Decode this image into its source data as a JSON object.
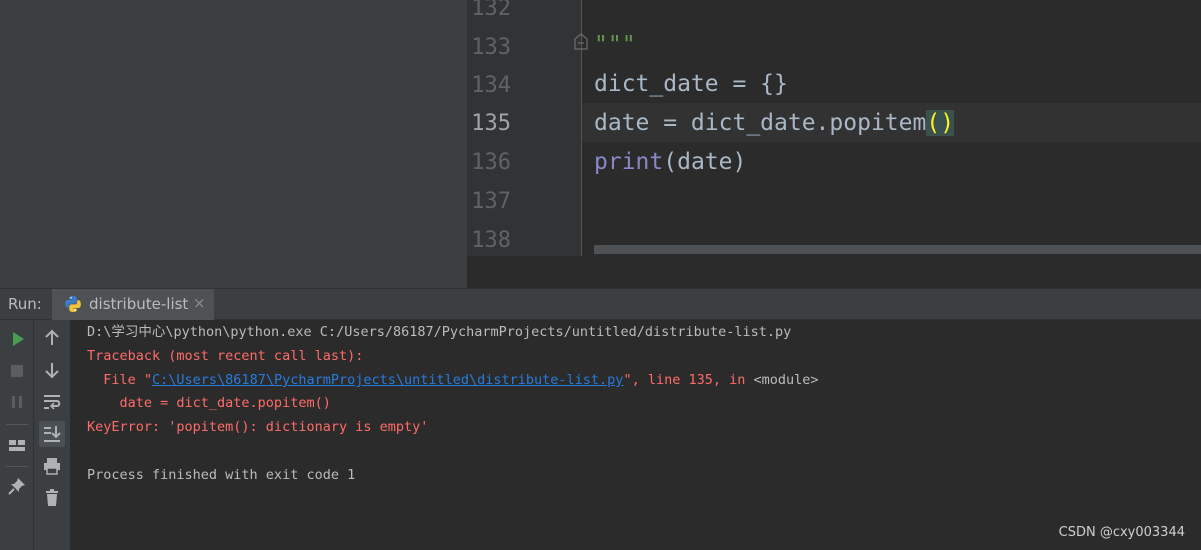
{
  "editor": {
    "line_numbers": [
      "132",
      "133",
      "134",
      "135",
      "136",
      "137",
      "138"
    ],
    "current_line": "135",
    "code": {
      "l133_docstring": "\"\"\"",
      "l134": "dict_date = {}",
      "l135_pre": "date = dict_date.popitem",
      "l135_paren": "()",
      "l136_builtin": "print",
      "l136_rest": "(date)"
    }
  },
  "run_panel": {
    "label": "Run:",
    "tab_name": "distribute-list",
    "tab_close": "×",
    "tab_icon": "python-icon"
  },
  "console": {
    "cmd": "D:\\学习中心\\python\\python.exe C:/Users/86187/PycharmProjects/untitled/distribute-list.py",
    "traceback": "Traceback (most recent call last):",
    "file_pre": "  File \"",
    "file_link": "C:\\Users\\86187\\PycharmProjects\\untitled\\distribute-list.py",
    "file_post": "\", line 135, in ",
    "file_module": "<module>",
    "code_line": "    date = dict_date.popitem()",
    "error": "KeyError: 'popitem(): dictionary is empty'",
    "finished": "Process finished with exit code 1"
  },
  "watermark": "CSDN @cxy003344",
  "colors": {
    "background": "#2b2b2b",
    "panel": "#3c3f41",
    "error": "#ff6b68",
    "link": "#287bde",
    "run_green": "#499c54"
  }
}
